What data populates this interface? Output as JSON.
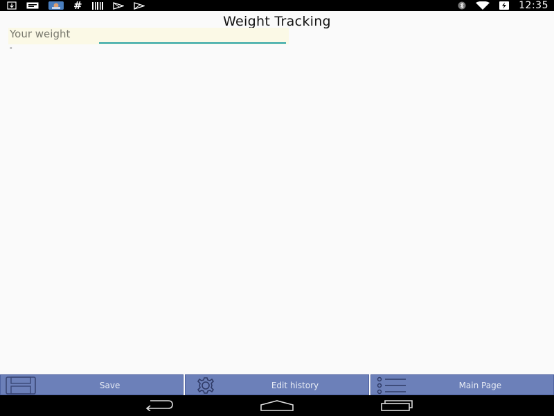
{
  "status_bar": {
    "time": "12:35",
    "left_icons": [
      "download-icon",
      "message-icon",
      "app-thumbnail-icon",
      "hash-icon",
      "barcode-icon",
      "play-store-icon",
      "play-store-icon"
    ],
    "right_icons": [
      "bluetooth-icon",
      "wifi-icon",
      "battery-charging-icon"
    ]
  },
  "page": {
    "title": "Weight Tracking"
  },
  "form": {
    "weight_label": "Your weight",
    "weight_value": "",
    "value_display": "-"
  },
  "bottom_bar": {
    "buttons": [
      {
        "label": "Save",
        "icon": "floppy-disk-icon"
      },
      {
        "label": "Edit history",
        "icon": "gear-icon"
      },
      {
        "label": "Main Page",
        "icon": "list-icon"
      }
    ]
  },
  "nav_bar": {
    "buttons": [
      "back-icon",
      "home-icon",
      "recent-apps-icon"
    ]
  },
  "colors": {
    "status_bar": "#000000",
    "background": "#fafafa",
    "input_row": "#fbf9e6",
    "input_underline": "#2aa3a3",
    "button_bg": "#6c80b9",
    "button_text": "#e8ecf5"
  }
}
